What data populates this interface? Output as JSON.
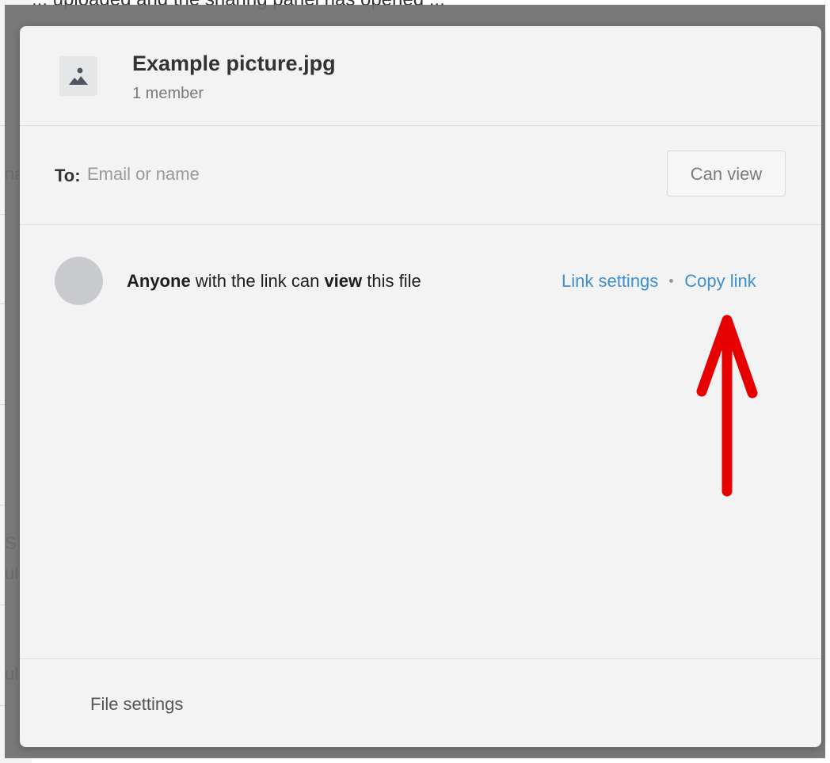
{
  "background": {
    "top_fragment": "... uploaded and the sharing panel has opened ...",
    "side_fragments": [
      "na",
      "S",
      "ul",
      "ul"
    ]
  },
  "modal": {
    "file": {
      "name": "Example picture.jpg",
      "members": "1 member",
      "thumbnail_icon": "image-icon"
    },
    "share": {
      "to_label": "To:",
      "input_placeholder": "Email or name",
      "input_value": "",
      "permission_button": "Can view"
    },
    "link": {
      "avatar_icon": "link-avatar",
      "text_parts": {
        "who": "Anyone",
        "middle": " with the link can ",
        "permission": "view",
        "end": " this file"
      },
      "link_settings": "Link settings",
      "copy_link": "Copy link"
    },
    "footer": {
      "file_settings": "File settings"
    }
  },
  "annotation": {
    "arrow_icon": "red-arrow-up-icon",
    "color": "#e60000"
  },
  "colors": {
    "modal_bg": "#f3f3f3",
    "link": "#3d8fd1",
    "overlay": "#6e6e6e"
  }
}
